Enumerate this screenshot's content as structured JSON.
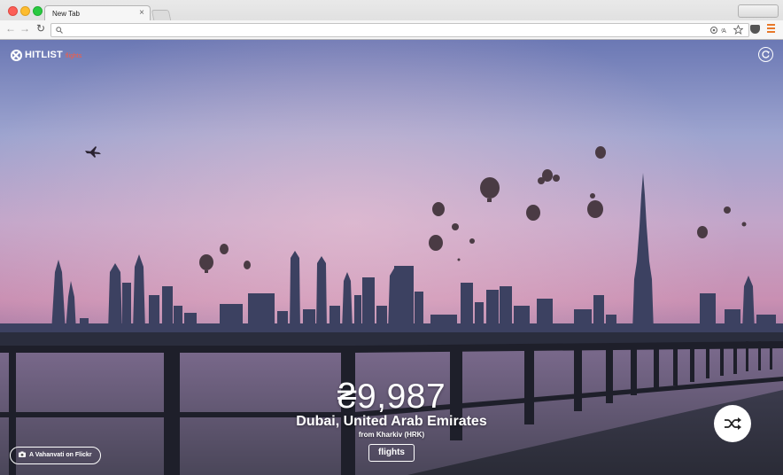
{
  "browser": {
    "tab_title": "New Tab",
    "tab_close": "×",
    "nav_back": "←",
    "nav_forward": "→",
    "nav_reload": "↻",
    "address_value": "",
    "omnibox_icons": [
      "location-icon",
      "translate-icon",
      "star-icon"
    ]
  },
  "app": {
    "logo_text": "HITLIST",
    "logo_sub": "flights",
    "accent_color": "#ff5a3c"
  },
  "deal": {
    "price": "₴9,987",
    "destination": "Dubai, United Arab Emirates",
    "origin": "from Kharkiv (HRK)",
    "cta_label": "flights"
  },
  "photo_credit": {
    "text": "A Vahanvati on Flickr"
  }
}
